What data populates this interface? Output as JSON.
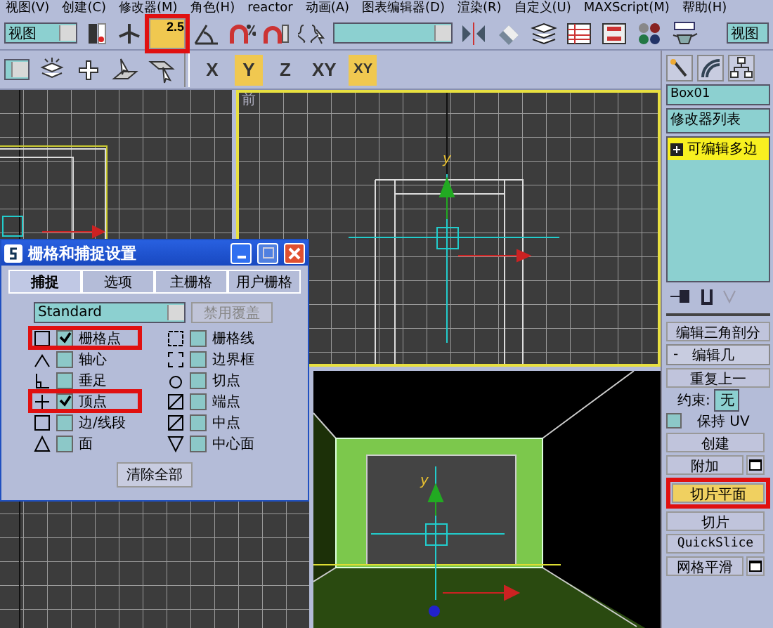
{
  "menu": [
    "视图(V)",
    "创建(C)",
    "修改器(M)",
    "角色(H)",
    "reactor",
    "动画(A)",
    "图表编辑器(D)",
    "渲染(R)",
    "自定义(U)",
    "MAXScript(M)",
    "帮助(H)"
  ],
  "toolbar": {
    "view_dropdown": "视图",
    "snap_button": {
      "label": "2.5",
      "selected": true,
      "highlighted": true
    },
    "view_dropdown_right": "视图"
  },
  "axis_buttons": [
    {
      "kind": "axis",
      "label": "X",
      "selected": false
    },
    {
      "kind": "axis",
      "label": "Y",
      "selected": true
    },
    {
      "kind": "axis",
      "label": "Z",
      "selected": false
    },
    {
      "kind": "axis",
      "label": "XY",
      "selected": false
    },
    {
      "kind": "snap",
      "label": "XY",
      "selected": true
    }
  ],
  "viewports": [
    {
      "kind": "left",
      "active": false
    },
    {
      "kind": "front",
      "active": true,
      "label": "前",
      "axis_label": "y"
    },
    {
      "kind": "top",
      "active": false
    },
    {
      "kind": "perspective",
      "active": false,
      "axis_label": "y"
    }
  ],
  "dialog": {
    "title": "栅格和捕捉设置",
    "tabs": [
      {
        "label": "捕捉",
        "selected": true
      },
      {
        "label": "选项",
        "selected": false
      },
      {
        "label": "主栅格",
        "selected": false
      },
      {
        "label": "用户栅格",
        "selected": false
      }
    ],
    "preset": "Standard",
    "override_button": {
      "label": "禁用覆盖",
      "disabled": true
    },
    "options": [
      {
        "label": "栅格点",
        "checked": true,
        "highlighted": true
      },
      {
        "label": "栅格线",
        "checked": false,
        "highlighted": false
      },
      {
        "label": "轴心",
        "checked": false,
        "highlighted": false
      },
      {
        "label": "边界框",
        "checked": false,
        "highlighted": false
      },
      {
        "label": "垂足",
        "checked": false,
        "highlighted": false
      },
      {
        "label": "切点",
        "checked": false,
        "highlighted": false
      },
      {
        "label": "顶点",
        "checked": true,
        "highlighted": true
      },
      {
        "label": "端点",
        "checked": false,
        "highlighted": false
      },
      {
        "label": "边/线段",
        "checked": false,
        "highlighted": false
      },
      {
        "label": "中点",
        "checked": false,
        "highlighted": false
      },
      {
        "label": "面",
        "checked": false,
        "highlighted": false
      },
      {
        "label": "中心面",
        "checked": false,
        "highlighted": false
      }
    ],
    "clear_button": "清除全部"
  },
  "command_panel": {
    "object_name": "Box01",
    "modifier_list": "修改器列表",
    "stack": [
      {
        "label": "可编辑多边",
        "selected": true
      }
    ],
    "triangulate_button": "编辑三角剖分",
    "rollout": {
      "sign": "-",
      "title": "编辑几"
    },
    "repeat_button": "重复上一",
    "constraint_label": "约束:",
    "constraint_value": "无",
    "preserve_uv": {
      "label": "保持 UV",
      "checked": false
    },
    "buttons": [
      {
        "label": "创建",
        "settings": false,
        "highlighted": false,
        "selected": false
      },
      {
        "label": "附加",
        "settings": true,
        "highlighted": false,
        "selected": false
      },
      {
        "label": "切片平面",
        "settings": false,
        "highlighted": true,
        "selected": true
      },
      {
        "label": "切片",
        "settings": false,
        "highlighted": false,
        "selected": false
      },
      {
        "label": "QuickSlice",
        "settings": false,
        "highlighted": false,
        "selected": false
      },
      {
        "label": "网格平滑",
        "settings": true,
        "highlighted": false,
        "selected": false
      }
    ]
  }
}
